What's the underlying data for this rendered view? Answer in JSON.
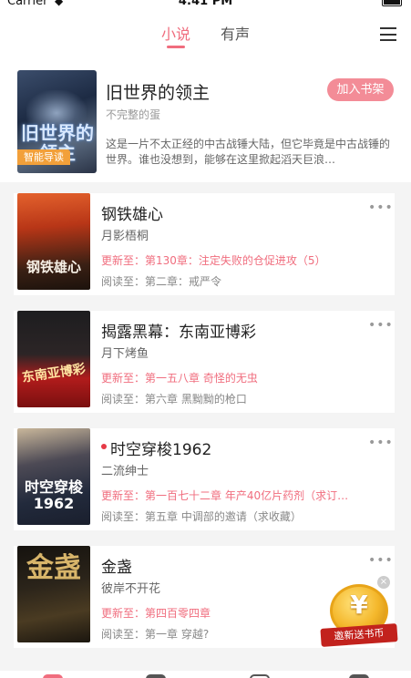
{
  "status_bar": {
    "carrier": "Carrier",
    "time": "4:41 PM"
  },
  "top_nav": {
    "tabs": [
      {
        "label": "小说",
        "active": true
      },
      {
        "label": "有声",
        "active": false
      }
    ]
  },
  "featured": {
    "cover_text": "旧世界的领主",
    "badge": "智能导读",
    "title": "旧世界的领主",
    "author": "不完整的蛋",
    "add_button": "加入书架",
    "description": "这是一片不太正经的中古战锤大陆，但它毕竟是中古战锤的世界。谁也没想到，能够在这里掀起滔天巨浪…"
  },
  "books": [
    {
      "cover_text": "钢铁雄心",
      "title": "钢铁雄心",
      "author": "月影梧桐",
      "update": "更新至：第130章：注定失败的仓促进攻（5）",
      "read": "阅读至：第二章：戒严令",
      "new": false
    },
    {
      "cover_text": "东南亚博彩",
      "title": "揭露黑幕：东南亚博彩",
      "author": "月下烤鱼",
      "update": "更新至：第一五八章 奇怪的无虫",
      "read": "阅读至：第六章 黑黝黝的枪口",
      "new": false
    },
    {
      "cover_text": "时空穿梭1962",
      "title": "时空穿梭1962",
      "author": "二流绅士",
      "update": "更新至：第一百七十二章 年产40亿片药剂（求订…",
      "read": "阅读至：第五章 中调部的邀请（求收藏）",
      "new": true
    },
    {
      "cover_text": "金盏",
      "title": "金盏",
      "author": "彼岸不开花",
      "update": "更新至：第四百零四章",
      "read": "阅读至：第一章 穿越?",
      "new": false
    }
  ],
  "more_glyph": "•••",
  "promo": {
    "symbol": "¥",
    "label": "邀新送书币",
    "close": "×"
  },
  "colors": {
    "accent": "#f06d7e",
    "button": "#f38c97",
    "badge": "#f2a03a"
  }
}
